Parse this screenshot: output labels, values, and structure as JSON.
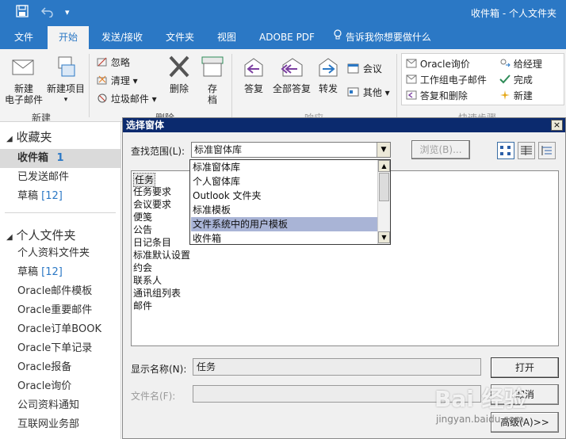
{
  "window": {
    "title": "收件箱 - 个人文件夹",
    "qa_save_icon": "save-icon",
    "qa_undo_icon": "undo-icon",
    "qa_customize": "▾"
  },
  "tabs": [
    {
      "label": "文件"
    },
    {
      "label": "开始"
    },
    {
      "label": "发送/接收"
    },
    {
      "label": "文件夹"
    },
    {
      "label": "视图"
    },
    {
      "label": "ADOBE PDF"
    },
    {
      "label": "告诉我你想要做什么"
    }
  ],
  "ribbon": {
    "new_email": "新建\n电子邮件",
    "new_email_1": "新建",
    "new_email_2": "电子邮件",
    "new_items": "新建项目",
    "new_items_arrow": "▾",
    "group_new": "新建",
    "ignore": "忽略",
    "clean": "清理",
    "junk": "垃圾邮件",
    "delete": "删除",
    "archive_1": "存",
    "archive_2": "档",
    "group_delete": "删除",
    "reply": "答复",
    "reply_all": "全部答复",
    "forward": "转发",
    "meeting": "会议",
    "more": "其他",
    "group_respond": "响应",
    "qs_oracle_inquiry": "Oracle询价",
    "qs_team_email": "工作组电子邮件",
    "qs_reply_delete": "答复和删除",
    "qs_to_manager": "给经理",
    "qs_done": "完成",
    "qs_new": "新建",
    "group_quicksteps": "快速步骤"
  },
  "folder_pane": {
    "favorites_header": "收藏夹",
    "favorites": [
      {
        "label": "收件箱",
        "count": "1",
        "selected": true
      },
      {
        "label": "已发送邮件",
        "count": ""
      },
      {
        "label": "草稿",
        "count": "[12]"
      }
    ],
    "personal_header": "个人文件夹",
    "personal": [
      {
        "label": "个人资料文件夹",
        "count": ""
      },
      {
        "label": "草稿",
        "count": "[12]"
      },
      {
        "label": "Oracle邮件模板",
        "count": ""
      },
      {
        "label": "Oracle重要邮件",
        "count": ""
      },
      {
        "label": "Oracle订单BOOK",
        "count": ""
      },
      {
        "label": "Oracle下单记录",
        "count": ""
      },
      {
        "label": "Oracle报备",
        "count": ""
      },
      {
        "label": "Oracle询价",
        "count": ""
      },
      {
        "label": "公司资料通知",
        "count": ""
      },
      {
        "label": "互联网业务部",
        "count": ""
      }
    ]
  },
  "dialog": {
    "title": "选择窗体",
    "close": "×",
    "look_in_label": "查找范围(L):",
    "look_in_value": "标准窗体库",
    "browse": "浏览(B)...",
    "dropdown_options": [
      {
        "label": "标准窗体库"
      },
      {
        "label": "个人窗体库"
      },
      {
        "label": "Outlook 文件夹"
      },
      {
        "label": "标准模板"
      },
      {
        "label": "文件系统中的用户模板",
        "highlighted": true
      },
      {
        "label": "收件箱"
      }
    ],
    "forms": [
      "任务",
      "任务要求",
      "会议要求",
      "便笺",
      "公告",
      "日记条目",
      "标准默认设置",
      "约会",
      "联系人",
      "通讯组列表",
      "邮件"
    ],
    "display_name_label": "显示名称(N):",
    "display_name_value": "任务",
    "file_name_label": "文件名(F):",
    "file_name_value": "",
    "open": "打开",
    "cancel": "取消",
    "advanced": "高级(A)>>"
  },
  "watermark": {
    "brand": "Bai 经验",
    "url": "jingyan.baidu.com"
  },
  "colors": {
    "accent": "#2b78c5",
    "dialog_title": "#0b2a6e",
    "dropdown_highlight": "#a9b4d6"
  }
}
